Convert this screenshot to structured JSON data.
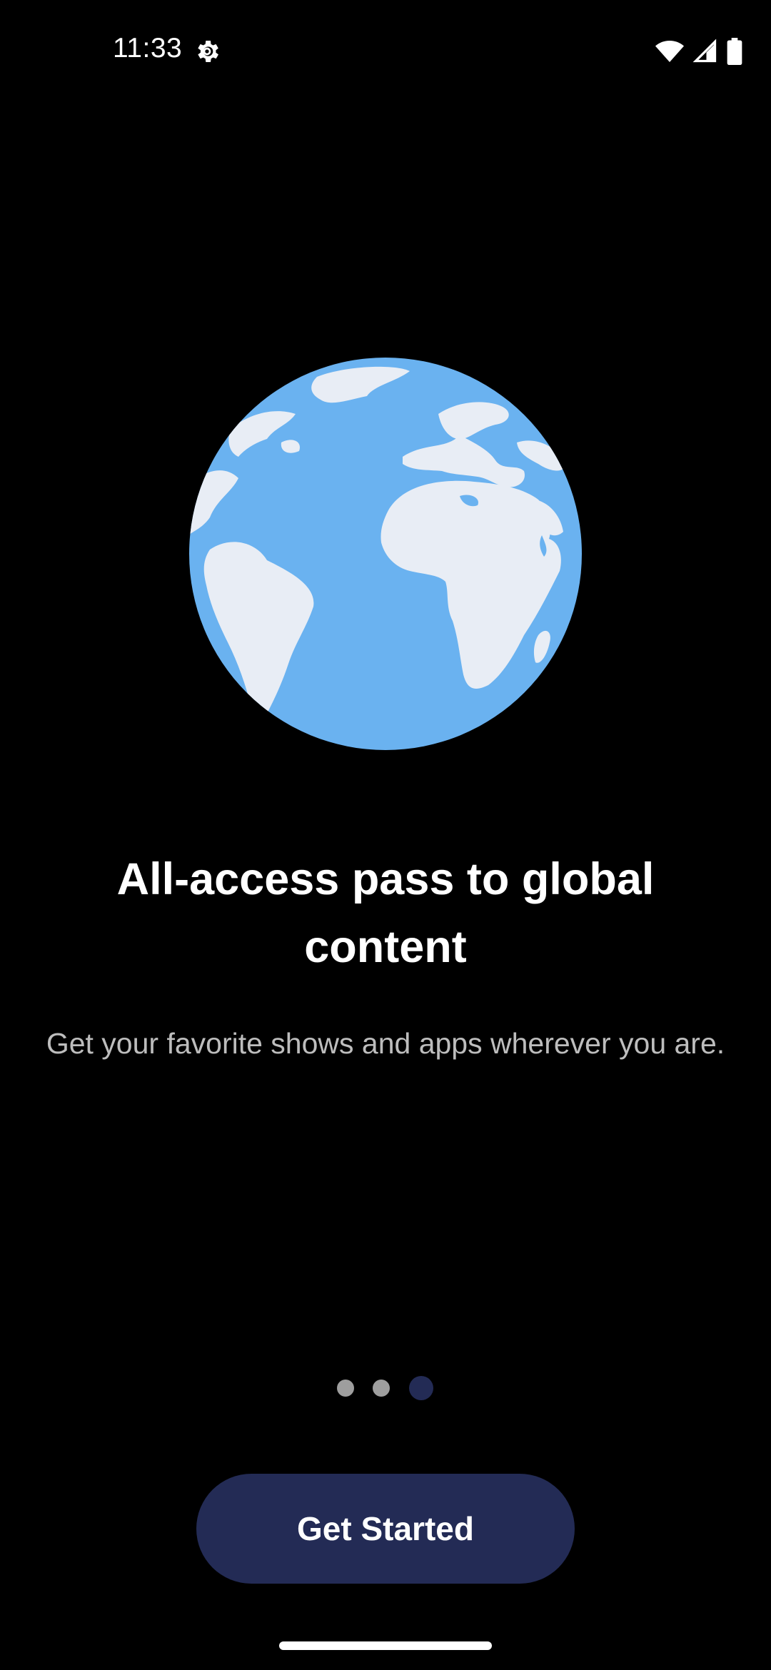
{
  "status_bar": {
    "time": "11:33",
    "icons": [
      "settings-gear-icon",
      "wifi-icon",
      "cell-signal-icon",
      "battery-icon"
    ]
  },
  "illustration": {
    "name": "globe-illustration",
    "colors": {
      "ocean": "#6ab2f0",
      "land": "#e8edf5"
    }
  },
  "onboarding": {
    "title": "All-access pass to global content",
    "subtitle": "Get your favorite shows and apps wherever you are.",
    "page_count": 3,
    "active_page": 3
  },
  "cta": {
    "label": "Get Started"
  },
  "colors": {
    "background": "#000000",
    "accent": "#232b55",
    "inactive_dot": "#9e9e9e",
    "subtitle_text": "#bdbdbd"
  }
}
